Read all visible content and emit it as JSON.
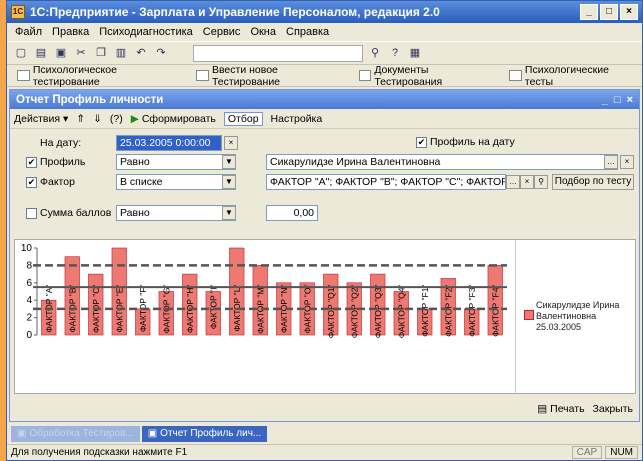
{
  "window": {
    "title": "1С:Предприятие - Зарплата и Управление Персоналом, редакция 2.0",
    "min": "_",
    "max": "□",
    "close": "×"
  },
  "menu": [
    "Файл",
    "Правка",
    "Психодиагностика",
    "Сервис",
    "Окна",
    "Справка"
  ],
  "quickbar": [
    "Психологическое тестирование",
    "Ввести новое Тестирование",
    "Документы Тестирования",
    "Психологические тесты"
  ],
  "report": {
    "title": "Отчет  Профиль  личности",
    "actions": {
      "actions_label": "Действия",
      "generate": "Сформировать",
      "filter": "Отбор",
      "settings": "Настройка"
    },
    "date_label": "На дату:",
    "date_value": "25.03.2005 0:00:00",
    "profile_on_date_label": "Профиль на дату",
    "profile_label": "Профиль",
    "profile_cond": "Равно",
    "profile_value": "Сикарулидзе Ирина Валентиновна",
    "factor_label": "Фактор",
    "factor_cond": "В списке",
    "factor_value": "ФАКТОР \"А\"; ФАКТОР \"В\"; ФАКТОР \"С\"; ФАКТОР \"Е\"",
    "factor_btn": "Подбор по тесту",
    "score_label": "Сумма баллов",
    "score_cond": "Равно",
    "score_value": "0,00",
    "print": "Печать",
    "close": "Закрыть"
  },
  "chart_data": {
    "type": "bar",
    "ylim": [
      0,
      10
    ],
    "y_ticks": [
      0,
      2,
      4,
      6,
      8,
      10
    ],
    "reference_lines": [
      8,
      5.5,
      3
    ],
    "categories": [
      "ФАКТОР \"A\"",
      "ФАКТОР \"B\"",
      "ФАКТОР \"C\"",
      "ФАКТОР \"E\"",
      "ФАКТОР \"F\"",
      "ФАКТОР \"G\"",
      "ФАКТОР \"H\"",
      "ФАКТОР \"I\"",
      "ФАКТОР \"L\"",
      "ФАКТОР \"M\"",
      "ФАКТОР \"N\"",
      "ФАКТОР \"O\"",
      "ФАКТОР \"Q1\"",
      "ФАКТОР \"Q2\"",
      "ФАКТОР \"Q3\"",
      "ФАКТОР \"Q4\"",
      "ФАКТОР \"F1\"",
      "ФАКТОР \"F2\"",
      "ФАКТОР \"F3\"",
      "ФАКТОР \"F4\""
    ],
    "series": [
      {
        "name": "Сикарулидзе Ирина Валентиновна 25.03.2005",
        "color": "#ec7a72",
        "values": [
          4,
          9,
          7,
          10,
          3,
          5,
          7,
          5,
          10,
          8,
          6,
          6,
          7,
          6,
          7,
          5,
          3,
          6.5,
          3,
          8
        ]
      }
    ]
  },
  "taskbar": [
    {
      "label": "Обработка Тестиров...",
      "active": false
    },
    {
      "label": "Отчет  Профиль лич...",
      "active": true
    }
  ],
  "status": {
    "hint": "Для получения подсказки нажмите F1",
    "cap": "CAP",
    "num": "NUM"
  }
}
